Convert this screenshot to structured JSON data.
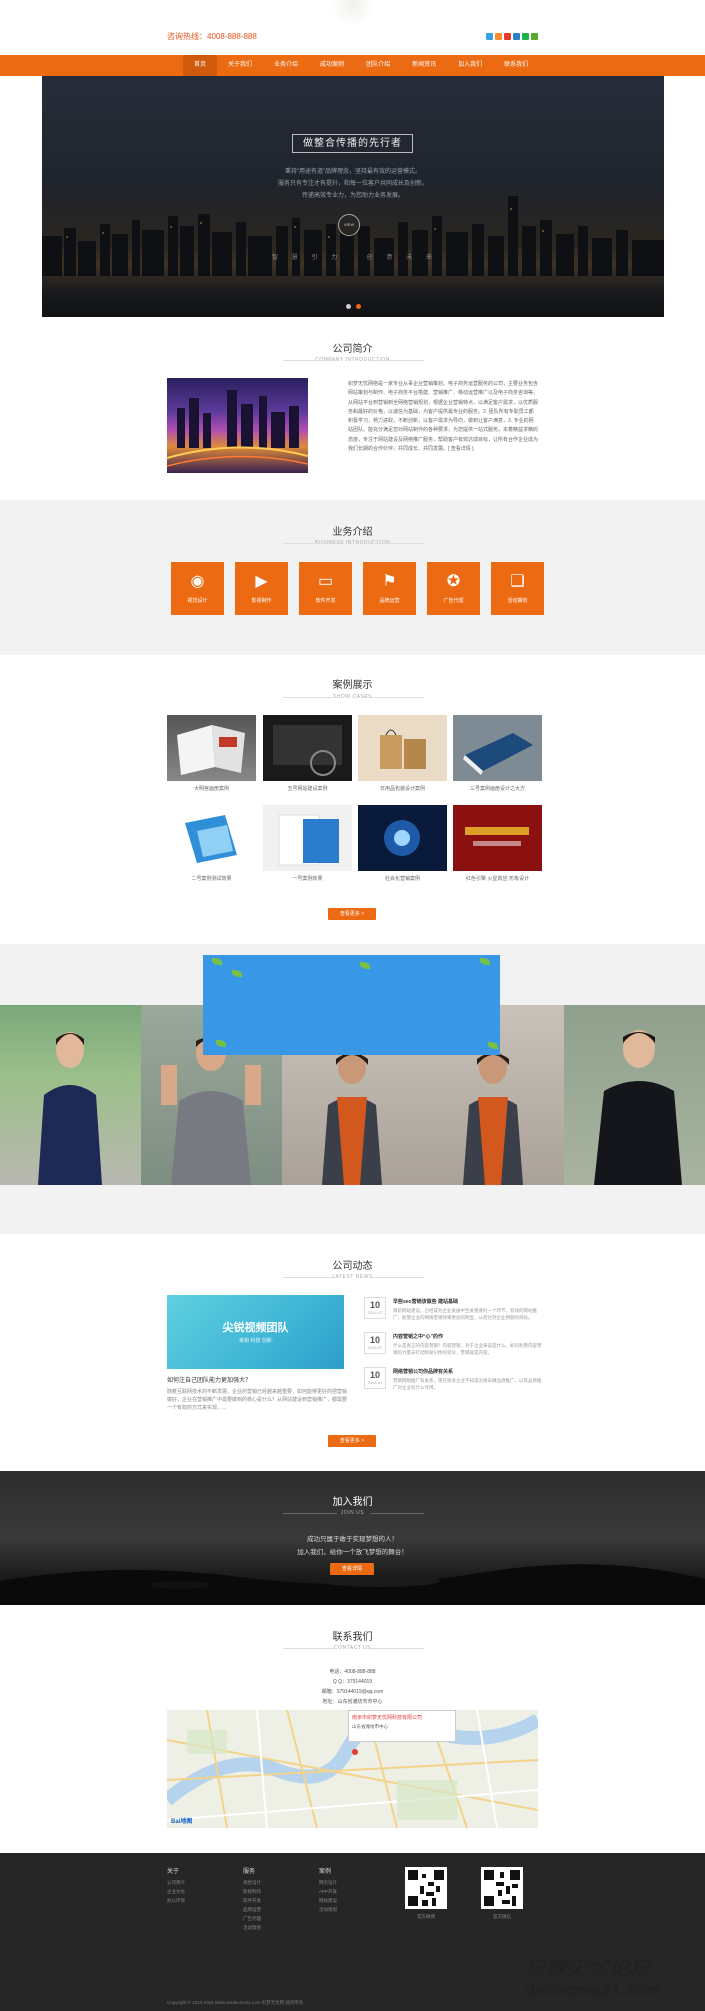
{
  "header": {
    "hotline": "咨询热线：4008-888-888"
  },
  "nav": {
    "items": [
      "首页",
      "关于我们",
      "业务介绍",
      "成功案例",
      "团队介绍",
      "新闻资讯",
      "加入我们",
      "联系我们"
    ],
    "active_index": 0
  },
  "hero": {
    "title": "做整合传播的先行者",
    "lines": [
      "秉持“用途有道”品牌理念，坚持最有效的运营模式。",
      "服务只有专注才有提升，和每一位客户共同成长及创新。",
      "传递高效专业力，为您助力业务发展。"
    ],
    "hex_label": "VIEW",
    "tags": [
      "智",
      "慧",
      "引",
      "力",
      "·",
      "创",
      "意",
      "未",
      "来"
    ],
    "slides": 2
  },
  "intro": {
    "title": "公司简介",
    "sub": "COMPANY INTRODUCTION",
    "text": "织梦无忧网络是一家专业从事企业营销策划、电子商务运营服务的公司，主要业务包含网站策划与制作、电子商务平台搭建、营销推广、移动运营推广以及电子商务咨询等。从网站平台到营销到全网络营销规划，根据企业营销特点，以满足客户需求，以优质服务和最好的价格，以诚信为基础，为客户提供最专业的服务。2. 团队所有专职员工都积极学习，努力进取，不断创新，以客户需求为导向，做到让客户满意，3. 专业的网站团队，能充分满足您对网站制作的各种要求，为您提供一站式服务。本着精益求精的态度，专注于网站建设及网络推广服务，帮助客户有效达成目标，让所有合作企业成为我们长期的合作伙伴，共同成长、共同发展。[ 查看详情 ]"
  },
  "business": {
    "title": "业务介绍",
    "sub": "BUSINESS INTRODUCTION",
    "items": [
      {
        "label": "视觉设计",
        "icon": "palette-icon"
      },
      {
        "label": "影视制作",
        "icon": "video-camera-icon"
      },
      {
        "label": "软件开发",
        "icon": "laptop-icon"
      },
      {
        "label": "品牌运营",
        "icon": "flag-icon"
      },
      {
        "label": "广告代理",
        "icon": "award-icon"
      },
      {
        "label": "活动策划",
        "icon": "book-icon"
      }
    ]
  },
  "cases": {
    "title": "案例展示",
    "sub": "SHOW CASES",
    "items": [
      "大明宫画册案例",
      "五号网站建设案例",
      "日用品包装设计案例",
      "三号案例画册设计之大方",
      "二号案例测试效果",
      "一号案例效果",
      "社会化营销案例",
      "红色引擎·火星效应·形象设计"
    ],
    "more": "查看更多 >"
  },
  "news": {
    "title": "公司动态",
    "sub": "LATEST NEWS",
    "feature_caption": "如何注自己团队能力更加强大？",
    "feature_summary": "随着互联网技术的不断发展，企业的营销已经越来越重要，如何能够更好的把营销做好，企业在营销推广中需要做到的核心是什么？从网站建设到营销推广，都需要一个有效的方式来实现，...",
    "feature_banner": "尖锐视频团队",
    "feature_banner_sub": "·亲和 科技 创新·",
    "list": [
      {
        "day": "10",
        "ym": "2014-07",
        "title": "早些seo营销该做些 建站基础",
        "summary": "目前网站建设，已经成为企业发展中至关重要的一个环节，有效的网站推广，能使企业的网络营销效果更加的明显，从而达到企业预期的目标。"
      },
      {
        "day": "10",
        "ym": "2014-07",
        "title": "内容营销之中“心”的作",
        "summary": "什么是真正的内容营销？内容营销，对于企业来说是什么，如何利用内容营销的力量去打动和吸引你的受众，营销就是内容。"
      },
      {
        "day": "10",
        "ym": "2014-07",
        "title": "网络营销公司你品牌有关系",
        "summary": "营销网络推广有关系，现在很多企业不知道怎样去做品牌推广，以及品牌推广对企业有什么作用。"
      }
    ],
    "more": "查看更多 >"
  },
  "join": {
    "title": "加入我们",
    "sub": "JOIN US",
    "line1": "成功只属于敢于实现梦想的人！",
    "line2": "加入我们，给你一个放飞梦想的舞台！",
    "button": "查看详情"
  },
  "contact": {
    "title": "联系我们",
    "sub": "CONTACT US",
    "phone": "电话：4008-888-888",
    "qq": "Q Q：379144019",
    "email": "邮箱：379144019@qq.com",
    "address": "地址：山东省潍坊市市中心",
    "map_popup_title": "南京市织梦无忧网科技有限公司",
    "map_popup_sub": "山东省潍坊市中心"
  },
  "footer": {
    "cols": [
      {
        "title": "关于",
        "items": [
          "公司简介",
          "企业文化",
          "办公环境"
        ]
      },
      {
        "title": "服务",
        "items": [
          "视觉设计",
          "影视制作",
          "软件开发",
          "品牌运营",
          "广告代理",
          "活动策划"
        ]
      },
      {
        "title": "案例",
        "items": [
          "网页设计",
          "APP开发",
          "网站建设",
          "活动策划"
        ]
      }
    ],
    "qr": [
      "官方微博",
      "官方微信"
    ],
    "copyright": "Copyright © 2014-2015 Www.Dedecms51.com 织梦无忧网 版权所有",
    "watermark": "织梦无忧论坛",
    "watermark_url": "dedecms51.com"
  },
  "colors": {
    "accent": "#ec6a12",
    "nav_active": "#cf5a0c",
    "footer_bg": "#262626"
  }
}
